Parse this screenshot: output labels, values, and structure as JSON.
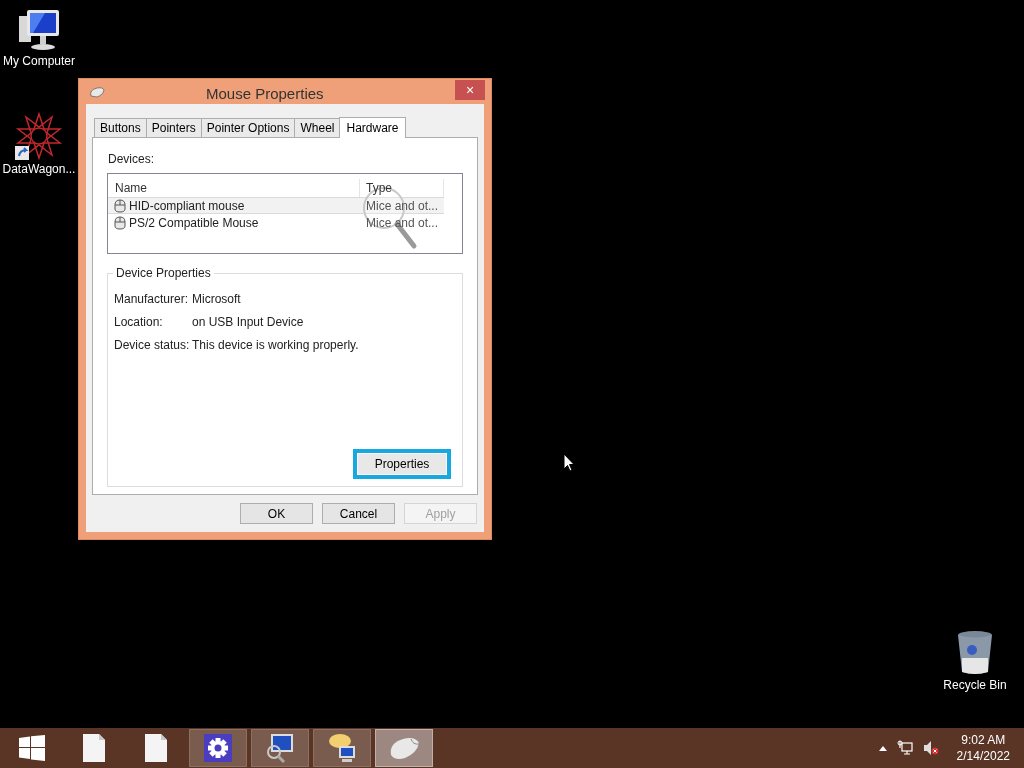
{
  "desktop_icons": [
    {
      "kind": "computer",
      "label": "My Computer"
    },
    {
      "kind": "app",
      "label": "DataWagon..."
    },
    {
      "kind": "recycle",
      "label": "Recycle Bin"
    }
  ],
  "window": {
    "title": "Mouse Properties",
    "close": "×"
  },
  "tabs": [
    {
      "label": "Buttons",
      "selected": false
    },
    {
      "label": "Pointers",
      "selected": false
    },
    {
      "label": "Pointer Options",
      "selected": false
    },
    {
      "label": "Wheel",
      "selected": false
    },
    {
      "label": "Hardware",
      "selected": true
    }
  ],
  "devices": {
    "label": "Devices:",
    "columns": [
      "Name",
      "Type"
    ],
    "rows": [
      {
        "name": "HID-compliant mouse",
        "type": "Mice and ot...",
        "selected": true
      },
      {
        "name": "PS/2 Compatible Mouse",
        "type": "Mice and ot...",
        "selected": false
      }
    ]
  },
  "device_properties": {
    "title": "Device Properties",
    "fields": [
      {
        "label": "Manufacturer:",
        "value": "Microsoft"
      },
      {
        "label": "Location:",
        "value": "on USB Input Device"
      },
      {
        "label": "Device status:",
        "value": "This device is working properly."
      }
    ],
    "button": {
      "label": "Properties",
      "focused": true
    }
  },
  "buttons": [
    {
      "label": "OK",
      "disabled": false
    },
    {
      "label": "Cancel",
      "disabled": false
    },
    {
      "label": "Apply",
      "disabled": true
    }
  ],
  "taskbar": {
    "items": [
      {
        "kind": "start",
        "running": false,
        "selected": false
      },
      {
        "kind": "file",
        "running": false,
        "selected": false
      },
      {
        "kind": "file",
        "running": false,
        "selected": false
      },
      {
        "kind": "settings",
        "running": true,
        "selected": false
      },
      {
        "kind": "monitor",
        "running": true,
        "selected": false
      },
      {
        "kind": "chat",
        "running": true,
        "selected": false
      },
      {
        "kind": "mouse",
        "running": true,
        "selected": true
      }
    ],
    "time": "9:02 AM",
    "date": "2/14/2022"
  }
}
